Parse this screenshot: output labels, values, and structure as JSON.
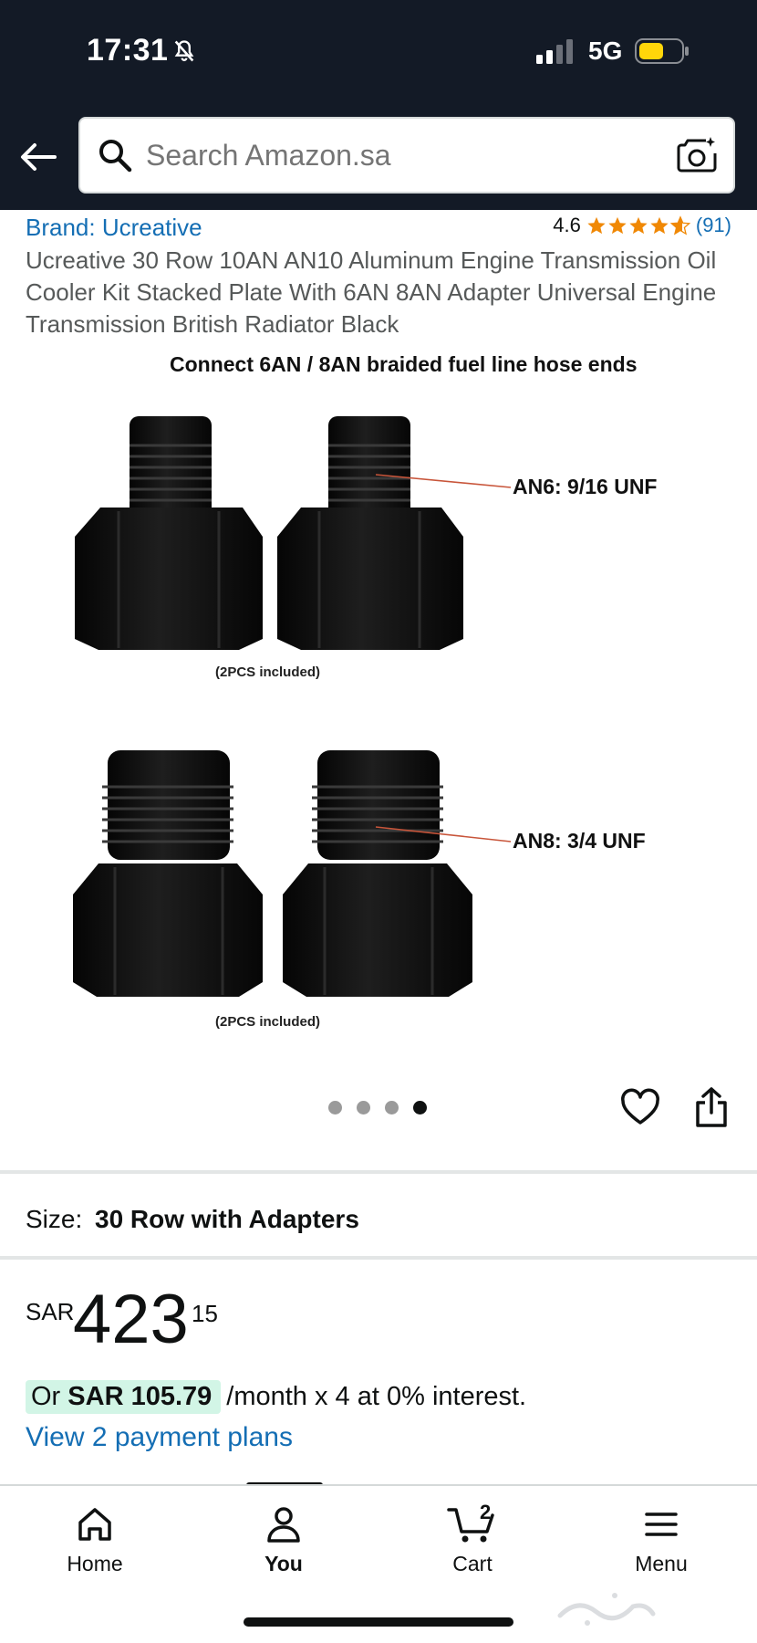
{
  "status_bar": {
    "time": "17:31",
    "network": "5G"
  },
  "search": {
    "placeholder": "Search Amazon.sa"
  },
  "product": {
    "brand": "Brand: Ucreative",
    "rating": "4.6",
    "rating_stars": 4.6,
    "rating_count": "(91)",
    "title": "Ucreative 30 Row 10AN AN10 Aluminum Engine Transmission Oil Cooler Kit Stacked Plate With 6AN 8AN Adapter Universal Engine Transmission British Radiator Black"
  },
  "image": {
    "heading": "Connect 6AN / 8AN braided fuel line hose ends",
    "label_an6": "AN6: 9/16 UNF",
    "label_an8": "AN8: 3/4 UNF",
    "caption_top": "(2PCS included)",
    "caption_bottom": "(2PCS included)",
    "carousel_total": 4,
    "carousel_active": 4
  },
  "size": {
    "label": "Size:",
    "value": "30 Row with Adapters"
  },
  "price": {
    "currency": "SAR",
    "whole": "423",
    "fraction": "15"
  },
  "installment": {
    "prefix": "Or ",
    "amount": "SAR 105.79",
    "suffix": "/month x 4 at 0% interest."
  },
  "payment_plans_link": "View 2 payment plans",
  "tabs": [
    {
      "label": "Home",
      "icon": "home-icon"
    },
    {
      "label": "You",
      "icon": "person-icon"
    },
    {
      "label": "Cart",
      "icon": "cart-icon",
      "badge": "2"
    },
    {
      "label": "Menu",
      "icon": "menu-icon"
    }
  ],
  "colors": {
    "header_bg": "#131a26",
    "link": "#146eb4",
    "star": "#f08804",
    "installment_highlight": "#d2f5e6",
    "battery": "#ffd60a"
  }
}
